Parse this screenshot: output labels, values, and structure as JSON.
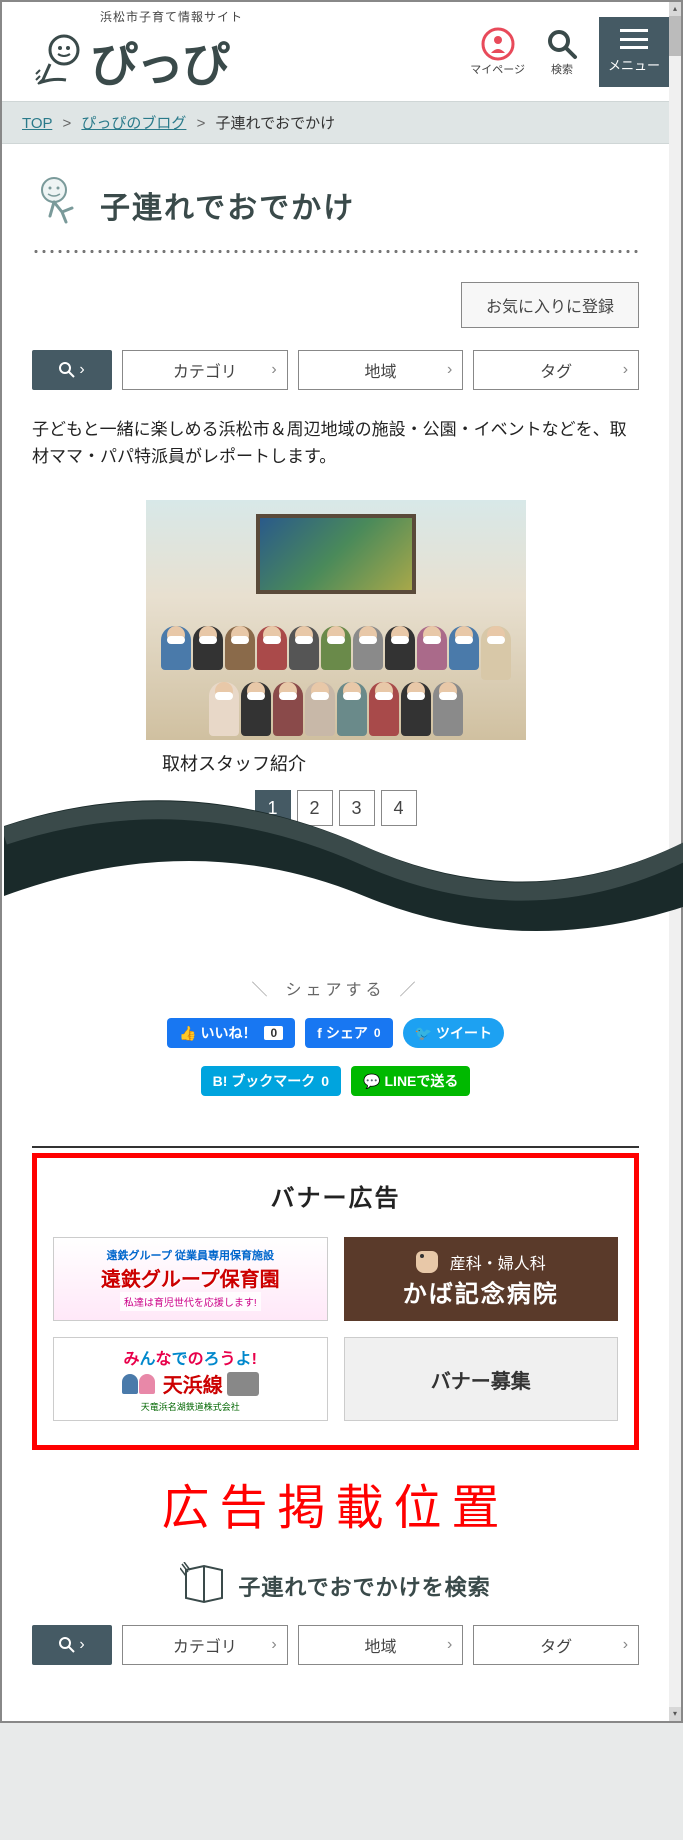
{
  "header": {
    "subtitle": "浜松市子育て情報サイト",
    "logo_text": "ぴっぴ",
    "mypage": "マイページ",
    "search": "検索",
    "menu": "メニュー"
  },
  "breadcrumb": {
    "top": "TOP",
    "blog": "ぴっぴのブログ",
    "current": "子連れでおでかけ"
  },
  "page": {
    "title": "子連れでおでかけ",
    "favorite_btn": "お気に入りに登録",
    "intro": "子どもと一緒に楽しめる浜松市＆周辺地域の施設・公園・イベントなどを、取材ママ・パパ特派員がレポートします。",
    "filters": {
      "category": "カテゴリ",
      "region": "地域",
      "tag": "タグ"
    },
    "staff_caption": "取材スタッフ紹介",
    "pagination": [
      "1",
      "2",
      "3",
      "4"
    ],
    "share": {
      "title": "シェアする",
      "fb_like": "いいね！",
      "fb_like_count": "0",
      "fb_share": "シェア",
      "fb_share_count": "0",
      "tweet": "ツイート",
      "hatena": "B! ブックマーク",
      "hatena_count": "0",
      "line": "LINEで送る"
    },
    "banner": {
      "title": "バナー広告",
      "b1_line1": "遠鉄グループ 従業員専用保育施設",
      "b1_line2": "遠鉄グループ保育園",
      "b1_line3": "私達は育児世代を応援します!",
      "b2_line1": "産科・婦人科",
      "b2_line2": "かば記念病院",
      "b3_line1": "みんなでのろうよ!",
      "b3_line2": "天浜線",
      "b3_line3": "天竜浜名湖鉄道株式会社",
      "b4": "バナー募集"
    },
    "ad_label": "広告掲載位置",
    "search_section_title": "子連れでおでかけを検索"
  }
}
